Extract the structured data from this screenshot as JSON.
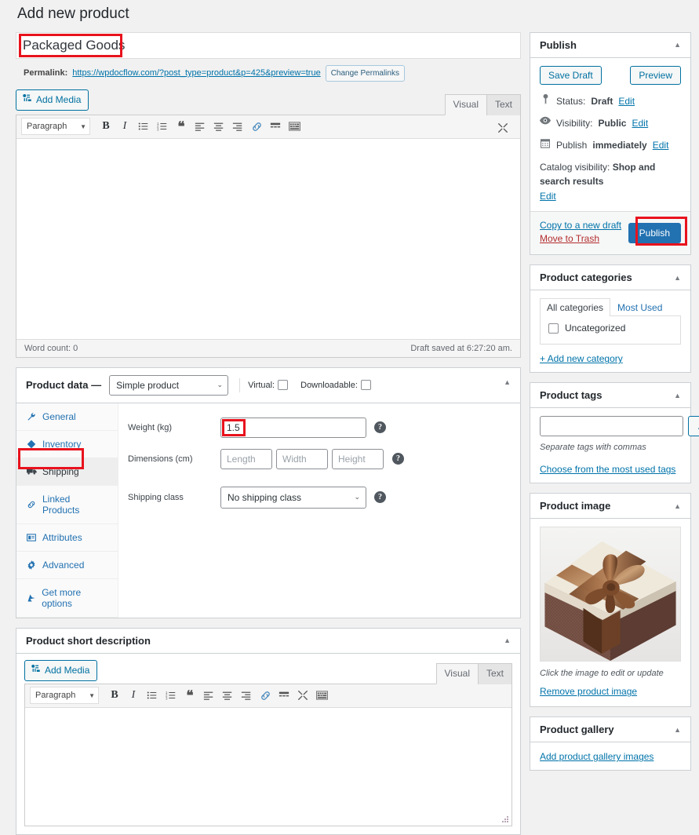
{
  "page": {
    "title": "Add new product"
  },
  "title_field": {
    "value": "Packaged Goods"
  },
  "permalink": {
    "label": "Permalink:",
    "url": "https://wpdocflow.com/?post_type=product&p=425&preview=true",
    "change_button": "Change Permalinks"
  },
  "editor": {
    "add_media": "Add Media",
    "tabs": [
      {
        "label": "Visual",
        "active": true
      },
      {
        "label": "Text",
        "active": false
      }
    ],
    "format_select": "Paragraph",
    "toolbar_icons": [
      "bold-icon",
      "italic-icon",
      "bulleted-list-icon",
      "numbered-list-icon",
      "blockquote-icon",
      "align-left-icon",
      "align-center-icon",
      "align-right-icon",
      "link-icon",
      "read-more-icon",
      "toolbar-toggle-icon"
    ],
    "fullscreen_icon": "fullscreen-icon",
    "word_count": "Word count: 0",
    "draft_saved": "Draft saved at 6:27:20 am."
  },
  "product_data": {
    "heading": "Product data —",
    "type_select": "Simple product",
    "virtual_label": "Virtual:",
    "downloadable_label": "Downloadable:",
    "tabs": [
      {
        "label": "General",
        "icon": "wrench-icon",
        "active": false
      },
      {
        "label": "Inventory",
        "icon": "tag-icon",
        "active": false
      },
      {
        "label": "Shipping",
        "icon": "truck-icon",
        "active": true
      },
      {
        "label": "Linked Products",
        "icon": "link-icon",
        "active": false
      },
      {
        "label": "Attributes",
        "icon": "attributes-icon",
        "active": false
      },
      {
        "label": "Advanced",
        "icon": "gear-icon",
        "active": false
      },
      {
        "label": "Get more options",
        "icon": "extension-icon",
        "active": false
      }
    ],
    "shipping": {
      "weight_label": "Weight (kg)",
      "weight_value": "1.5",
      "dimensions_label": "Dimensions (cm)",
      "length_placeholder": "Length",
      "width_placeholder": "Width",
      "height_placeholder": "Height",
      "shipping_class_label": "Shipping class",
      "shipping_class_value": "No shipping class",
      "help_icon": "help-icon"
    }
  },
  "short_description": {
    "heading": "Product short description",
    "add_media": "Add Media",
    "tabs": [
      {
        "label": "Visual",
        "active": true
      },
      {
        "label": "Text",
        "active": false
      }
    ],
    "format_select": "Paragraph"
  },
  "publish_box": {
    "heading": "Publish",
    "save_draft": "Save Draft",
    "preview": "Preview",
    "status_label": "Status:",
    "status_value": "Draft",
    "status_edit": "Edit",
    "visibility_label": "Visibility:",
    "visibility_value": "Public",
    "visibility_edit": "Edit",
    "publish_label": "Publish",
    "publish_value": "immediately",
    "publish_edit": "Edit",
    "catalog_label": "Catalog visibility:",
    "catalog_value": "Shop and search results",
    "catalog_edit": "Edit",
    "copy_draft": "Copy to a new draft",
    "move_trash": "Move to Trash",
    "publish_button": "Publish",
    "icons": {
      "status": "pin-icon",
      "visibility": "eye-icon",
      "schedule": "calendar-icon"
    }
  },
  "product_categories": {
    "heading": "Product categories",
    "tabs": [
      {
        "label": "All categories",
        "active": true
      },
      {
        "label": "Most Used",
        "active": false
      }
    ],
    "items": [
      {
        "label": "Uncategorized",
        "checked": false
      }
    ],
    "add_new": "+ Add new category"
  },
  "product_tags": {
    "heading": "Product tags",
    "input_value": "",
    "add_button": "Add",
    "hint": "Separate tags with commas",
    "most_used_link": "Choose from the most used tags"
  },
  "product_image": {
    "heading": "Product image",
    "image_alt": "gift-box-image",
    "caption": "Click the image to edit or update",
    "remove_link": "Remove product image"
  },
  "product_gallery": {
    "heading": "Product gallery",
    "add_link": "Add product gallery images"
  },
  "colors": {
    "highlight": "#e8121d",
    "primary": "#2271b1",
    "link": "#0073aa",
    "trash": "#b32d2e",
    "page_bg": "#f1f1f1"
  }
}
